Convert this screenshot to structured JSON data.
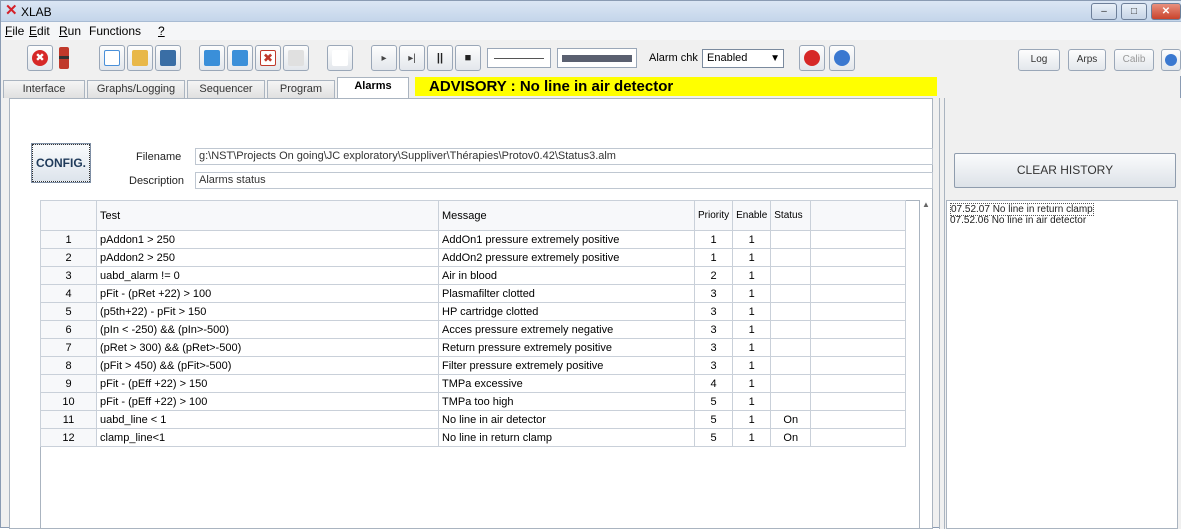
{
  "window": {
    "title": "XLAB",
    "minimize": "–",
    "maximize": "□",
    "close": "✕"
  },
  "menu": {
    "items": [
      {
        "ul": "F",
        "rest": "ile"
      },
      {
        "ul": "E",
        "rest": "dit"
      },
      {
        "ul": "R",
        "rest": "un"
      },
      {
        "ul": "",
        "rest": "Functions"
      },
      {
        "ul": "?",
        "rest": ""
      }
    ]
  },
  "toolbar": {
    "alarm_chk_label": "Alarm chk",
    "alarm_chk_value": "Enabled",
    "log": "Log",
    "arps": "Arps",
    "calib": "Calib",
    "icons": [
      {
        "name": "stop-icon",
        "color": "#d62828"
      },
      {
        "name": "battery-icon",
        "color": "#c0392b"
      },
      {
        "name": "new-file-icon",
        "color": "#4a90d9"
      },
      {
        "name": "open-folder-icon",
        "color": "#e8b84a"
      },
      {
        "name": "save-icon",
        "color": "#3a6ea5"
      },
      {
        "name": "export-icon",
        "color": "#3a8fd9"
      },
      {
        "name": "import-icon",
        "color": "#3a8fd9"
      },
      {
        "name": "delete-icon",
        "color": "#c0392b"
      },
      {
        "name": "table-icon",
        "color": "#bcbcbc"
      },
      {
        "name": "blank-icon",
        "color": "#ffffff"
      },
      {
        "name": "play-icon",
        "color": "#444"
      },
      {
        "name": "step-icon",
        "color": "#444"
      },
      {
        "name": "pause-icon",
        "color": "#222"
      },
      {
        "name": "stop-square-icon",
        "color": "#222"
      }
    ],
    "icon_glyphs": [
      "✖",
      "▮",
      "",
      "",
      "",
      "",
      "",
      "✖",
      "",
      "",
      "▸",
      "▸|",
      "||",
      "■"
    ]
  },
  "tabs": [
    "Interface",
    "Graphs/Logging",
    "Sequencer",
    "Program",
    "Alarms"
  ],
  "advisory": "ADVISORY : No line in air detector",
  "config": {
    "button": "CONFIG.",
    "filename_label": "Filename",
    "filename_value": "g:\\NST\\Projects On going\\JC exploratory\\Suppliver\\Thérapies\\Protov0.42\\Status3.alm",
    "description_label": "Description",
    "description_value": "Alarms status"
  },
  "table": {
    "headers": {
      "test": "Test",
      "message": "Message",
      "priority": "Priority",
      "enable": "Enable",
      "status": "Status"
    },
    "rows": [
      {
        "n": "1",
        "test": "pAddon1 > 250",
        "message": "AddOn1 pressure extremely positive",
        "priority": "1",
        "enable": "1",
        "status": ""
      },
      {
        "n": "2",
        "test": "pAddon2 > 250",
        "message": "AddOn2 pressure extremely positive",
        "priority": "1",
        "enable": "1",
        "status": ""
      },
      {
        "n": "3",
        "test": "uabd_alarm != 0",
        "message": "Air in blood",
        "priority": "2",
        "enable": "1",
        "status": ""
      },
      {
        "n": "4",
        "test": "pFit - (pRet +22) > 100",
        "message": "Plasmafilter clotted",
        "priority": "3",
        "enable": "1",
        "status": ""
      },
      {
        "n": "5",
        "test": "(p5th+22) - pFit > 150",
        "message": "HP cartridge clotted",
        "priority": "3",
        "enable": "1",
        "status": ""
      },
      {
        "n": "6",
        "test": "(pIn < -250) && (pIn>-500)",
        "message": "Acces pressure extremely negative",
        "priority": "3",
        "enable": "1",
        "status": ""
      },
      {
        "n": "7",
        "test": "(pRet > 300) && (pRet>-500)",
        "message": "Return pressure extremely positive",
        "priority": "3",
        "enable": "1",
        "status": ""
      },
      {
        "n": "8",
        "test": "(pFit > 450) && (pFit>-500)",
        "message": "Filter pressure extremely positive",
        "priority": "3",
        "enable": "1",
        "status": ""
      },
      {
        "n": "9",
        "test": "pFit - (pEff +22) > 150",
        "message": "TMPa excessive",
        "priority": "4",
        "enable": "1",
        "status": ""
      },
      {
        "n": "10",
        "test": "pFit - (pEff +22) > 100",
        "message": "TMPa too high",
        "priority": "5",
        "enable": "1",
        "status": ""
      },
      {
        "n": "11",
        "test": "uabd_line < 1",
        "message": "No line in air detector",
        "priority": "5",
        "enable": "1",
        "status": "On"
      },
      {
        "n": "12",
        "test": "clamp_line<1",
        "message": "No line in return clamp",
        "priority": "5",
        "enable": "1",
        "status": "On"
      }
    ]
  },
  "history": {
    "clear_button": "CLEAR HISTORY",
    "entries": [
      "07.52.07   No line in return clamp",
      "07.52.06   No line in air detector"
    ]
  }
}
